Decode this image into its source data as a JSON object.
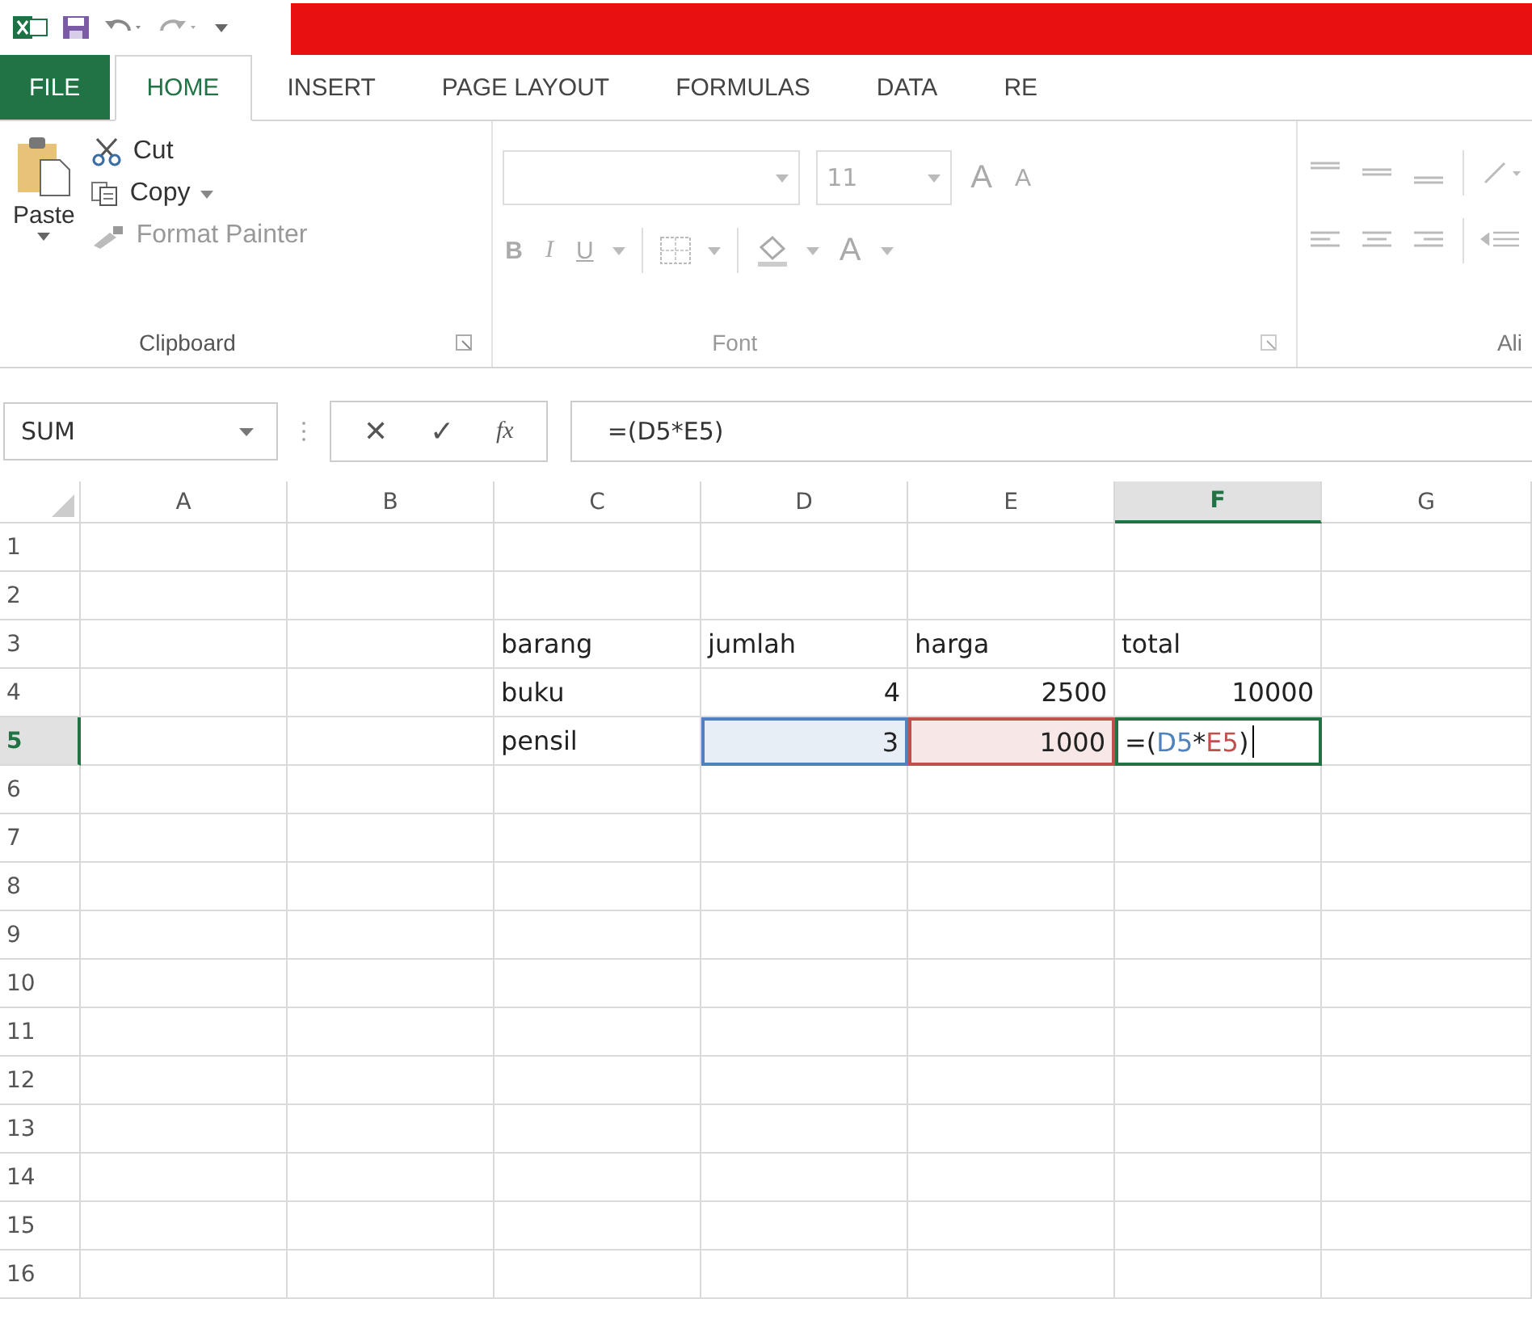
{
  "tabs": [
    {
      "label": "FILE",
      "kind": "file",
      "selected": false
    },
    {
      "label": "HOME",
      "kind": "tab",
      "selected": true
    },
    {
      "label": "INSERT",
      "kind": "tab",
      "selected": false
    },
    {
      "label": "PAGE LAYOUT",
      "kind": "tab",
      "selected": false
    },
    {
      "label": "FORMULAS",
      "kind": "tab",
      "selected": false
    },
    {
      "label": "DATA",
      "kind": "tab",
      "selected": false
    },
    {
      "label": "RE",
      "kind": "tab",
      "selected": false
    }
  ],
  "clipboard": {
    "paste": "Paste",
    "cut": "Cut",
    "copy": "Copy",
    "format_painter": {
      "label": "Format Painter",
      "disabled": true
    },
    "group_label": "Clipboard"
  },
  "font": {
    "size": "11",
    "grow": "A",
    "shrink": "A",
    "bold": "B",
    "italic": "I",
    "underline": "U",
    "font_color": "A",
    "group_label": "Font"
  },
  "alignment": {
    "group_label": "Ali"
  },
  "formula_bar": {
    "name_box": "SUM",
    "cancel": "✕",
    "enter": "✓",
    "fx": "fx",
    "formula": "=(D5*E5)"
  },
  "columns": [
    {
      "label": "A",
      "selected": false
    },
    {
      "label": "B",
      "selected": false
    },
    {
      "label": "C",
      "selected": false
    },
    {
      "label": "D",
      "selected": false
    },
    {
      "label": "E",
      "selected": false
    },
    {
      "label": "F",
      "selected": true
    },
    {
      "label": "G",
      "selected": false
    }
  ],
  "rows": [
    {
      "label": "1",
      "selected": false,
      "cells": [
        null,
        null,
        null,
        null,
        null,
        null,
        null
      ]
    },
    {
      "label": "2",
      "selected": false,
      "cells": [
        null,
        null,
        null,
        null,
        null,
        null,
        null
      ]
    },
    {
      "label": "3",
      "selected": false,
      "cells": [
        null,
        null,
        {
          "kind": "text",
          "text": "barang"
        },
        {
          "kind": "text",
          "text": "jumlah"
        },
        {
          "kind": "text",
          "text": "harga"
        },
        {
          "kind": "text",
          "text": "total"
        },
        null
      ]
    },
    {
      "label": "4",
      "selected": false,
      "cells": [
        null,
        null,
        {
          "kind": "text",
          "text": "buku"
        },
        {
          "kind": "number",
          "text": "4"
        },
        {
          "kind": "number",
          "text": "2500"
        },
        {
          "kind": "number",
          "text": "10000"
        },
        null
      ]
    },
    {
      "label": "5",
      "selected": true,
      "cells": [
        null,
        null,
        {
          "kind": "text",
          "text": "pensil"
        },
        {
          "kind": "number",
          "text": "3",
          "color": "#4f81bd"
        },
        {
          "kind": "number",
          "text": "1000",
          "color": "#c0504d"
        },
        {
          "kind": "formula",
          "editing": true,
          "parts": [
            {
              "text": "=("
            },
            {
              "text": "D5",
              "color": "#4f81bd"
            },
            {
              "text": "*"
            },
            {
              "text": "E5",
              "color": "#c0504d"
            },
            {
              "text": ")"
            }
          ]
        },
        null
      ]
    },
    {
      "label": "6",
      "selected": false,
      "cells": [
        null,
        null,
        null,
        null,
        null,
        null,
        null
      ]
    },
    {
      "label": "7",
      "selected": false,
      "cells": [
        null,
        null,
        null,
        null,
        null,
        null,
        null
      ]
    },
    {
      "label": "8",
      "selected": false,
      "cells": [
        null,
        null,
        null,
        null,
        null,
        null,
        null
      ]
    },
    {
      "label": "9",
      "selected": false,
      "cells": [
        null,
        null,
        null,
        null,
        null,
        null,
        null
      ]
    },
    {
      "label": "10",
      "selected": false,
      "cells": [
        null,
        null,
        null,
        null,
        null,
        null,
        null
      ]
    },
    {
      "label": "11",
      "selected": false,
      "cells": [
        null,
        null,
        null,
        null,
        null,
        null,
        null
      ]
    },
    {
      "label": "12",
      "selected": false,
      "cells": [
        null,
        null,
        null,
        null,
        null,
        null,
        null
      ]
    },
    {
      "label": "13",
      "selected": false,
      "cells": [
        null,
        null,
        null,
        null,
        null,
        null,
        null
      ]
    },
    {
      "label": "14",
      "selected": false,
      "cells": [
        null,
        null,
        null,
        null,
        null,
        null,
        null
      ]
    },
    {
      "label": "15",
      "selected": false,
      "cells": [
        null,
        null,
        null,
        null,
        null,
        null,
        null
      ]
    },
    {
      "label": "16",
      "selected": false,
      "cells": [
        null,
        null,
        null,
        null,
        null,
        null,
        null
      ]
    }
  ]
}
